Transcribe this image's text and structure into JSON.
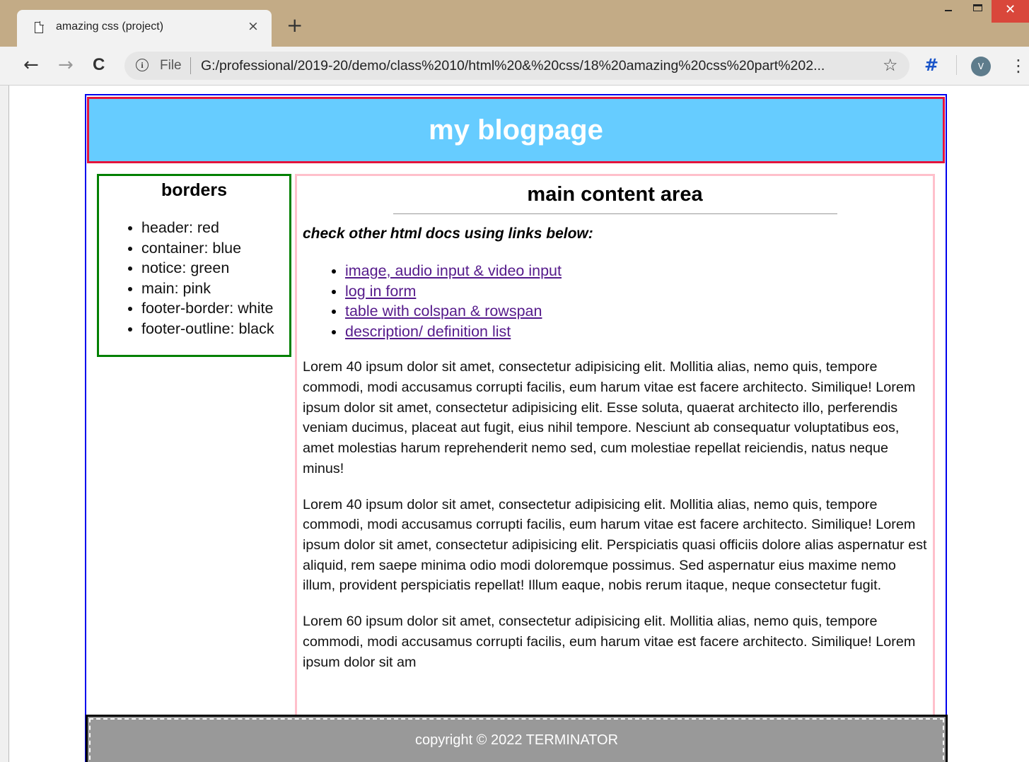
{
  "browser": {
    "tab_title": "amazing css (project)",
    "tab_close": "×",
    "new_tab": "+",
    "window_close": "✕",
    "back": "←",
    "forward": "→",
    "reload": "C",
    "scheme": "File",
    "url": "G:/professional/2019-20/demo/class%2010/html%20&%20css/18%20amazing%20css%20part%202...",
    "star": "☆",
    "extension_glyph": "#",
    "avatar_letter": "V",
    "menu": "⋮"
  },
  "header": {
    "title": "my blogpage"
  },
  "notice": {
    "title": "borders",
    "items": [
      "header: red",
      "container: blue",
      "notice: green",
      "main: pink",
      "footer-border: white",
      "footer-outline: black"
    ]
  },
  "main": {
    "title": "main content area",
    "lead": "check other html docs using links below:",
    "links": [
      "image, audio input & video input",
      "log in form",
      "table with colspan & rowspan",
      "description/ definition list"
    ],
    "paragraphs": [
      "Lorem 40 ipsum dolor sit amet, consectetur adipisicing elit. Mollitia alias, nemo quis, tempore commodi, modi accusamus corrupti facilis, eum harum vitae est facere architecto. Similique! Lorem ipsum dolor sit amet, consectetur adipisicing elit. Esse soluta, quaerat architecto illo, perferendis veniam ducimus, placeat aut fugit, eius nihil tempore. Nesciunt ab consequatur voluptatibus eos, amet molestias harum reprehenderit nemo sed, cum molestiae repellat reiciendis, natus neque minus!",
      "Lorem 40 ipsum dolor sit amet, consectetur adipisicing elit. Mollitia alias, nemo quis, tempore commodi, modi accusamus corrupti facilis, eum harum vitae est facere architecto. Similique! Lorem ipsum dolor sit amet, consectetur adipisicing elit. Perspiciatis quasi officiis dolore alias aspernatur est aliquid, rem saepe minima odio modi doloremque possimus. Sed aspernatur eius maxime nemo illum, provident perspiciatis repellat! Illum eaque, nobis rerum itaque, neque consectetur fugit.",
      "Lorem 60 ipsum dolor sit amet, consectetur adipisicing elit. Mollitia alias, nemo quis, tempore commodi, modi accusamus corrupti facilis, eum harum vitae est facere architecto. Similique! Lorem ipsum dolor sit am"
    ]
  },
  "footer": {
    "text": "copyright © 2022 TERMINATOR"
  },
  "colors": {
    "titlebar": "#c3ab86",
    "header_bg": "#66ccff",
    "header_border": "#e4143c",
    "container_border": "#0000ee",
    "notice_border": "#008000",
    "main_border": "#ffc0cb",
    "footer_bg": "#999999",
    "link": "#551a8b"
  }
}
